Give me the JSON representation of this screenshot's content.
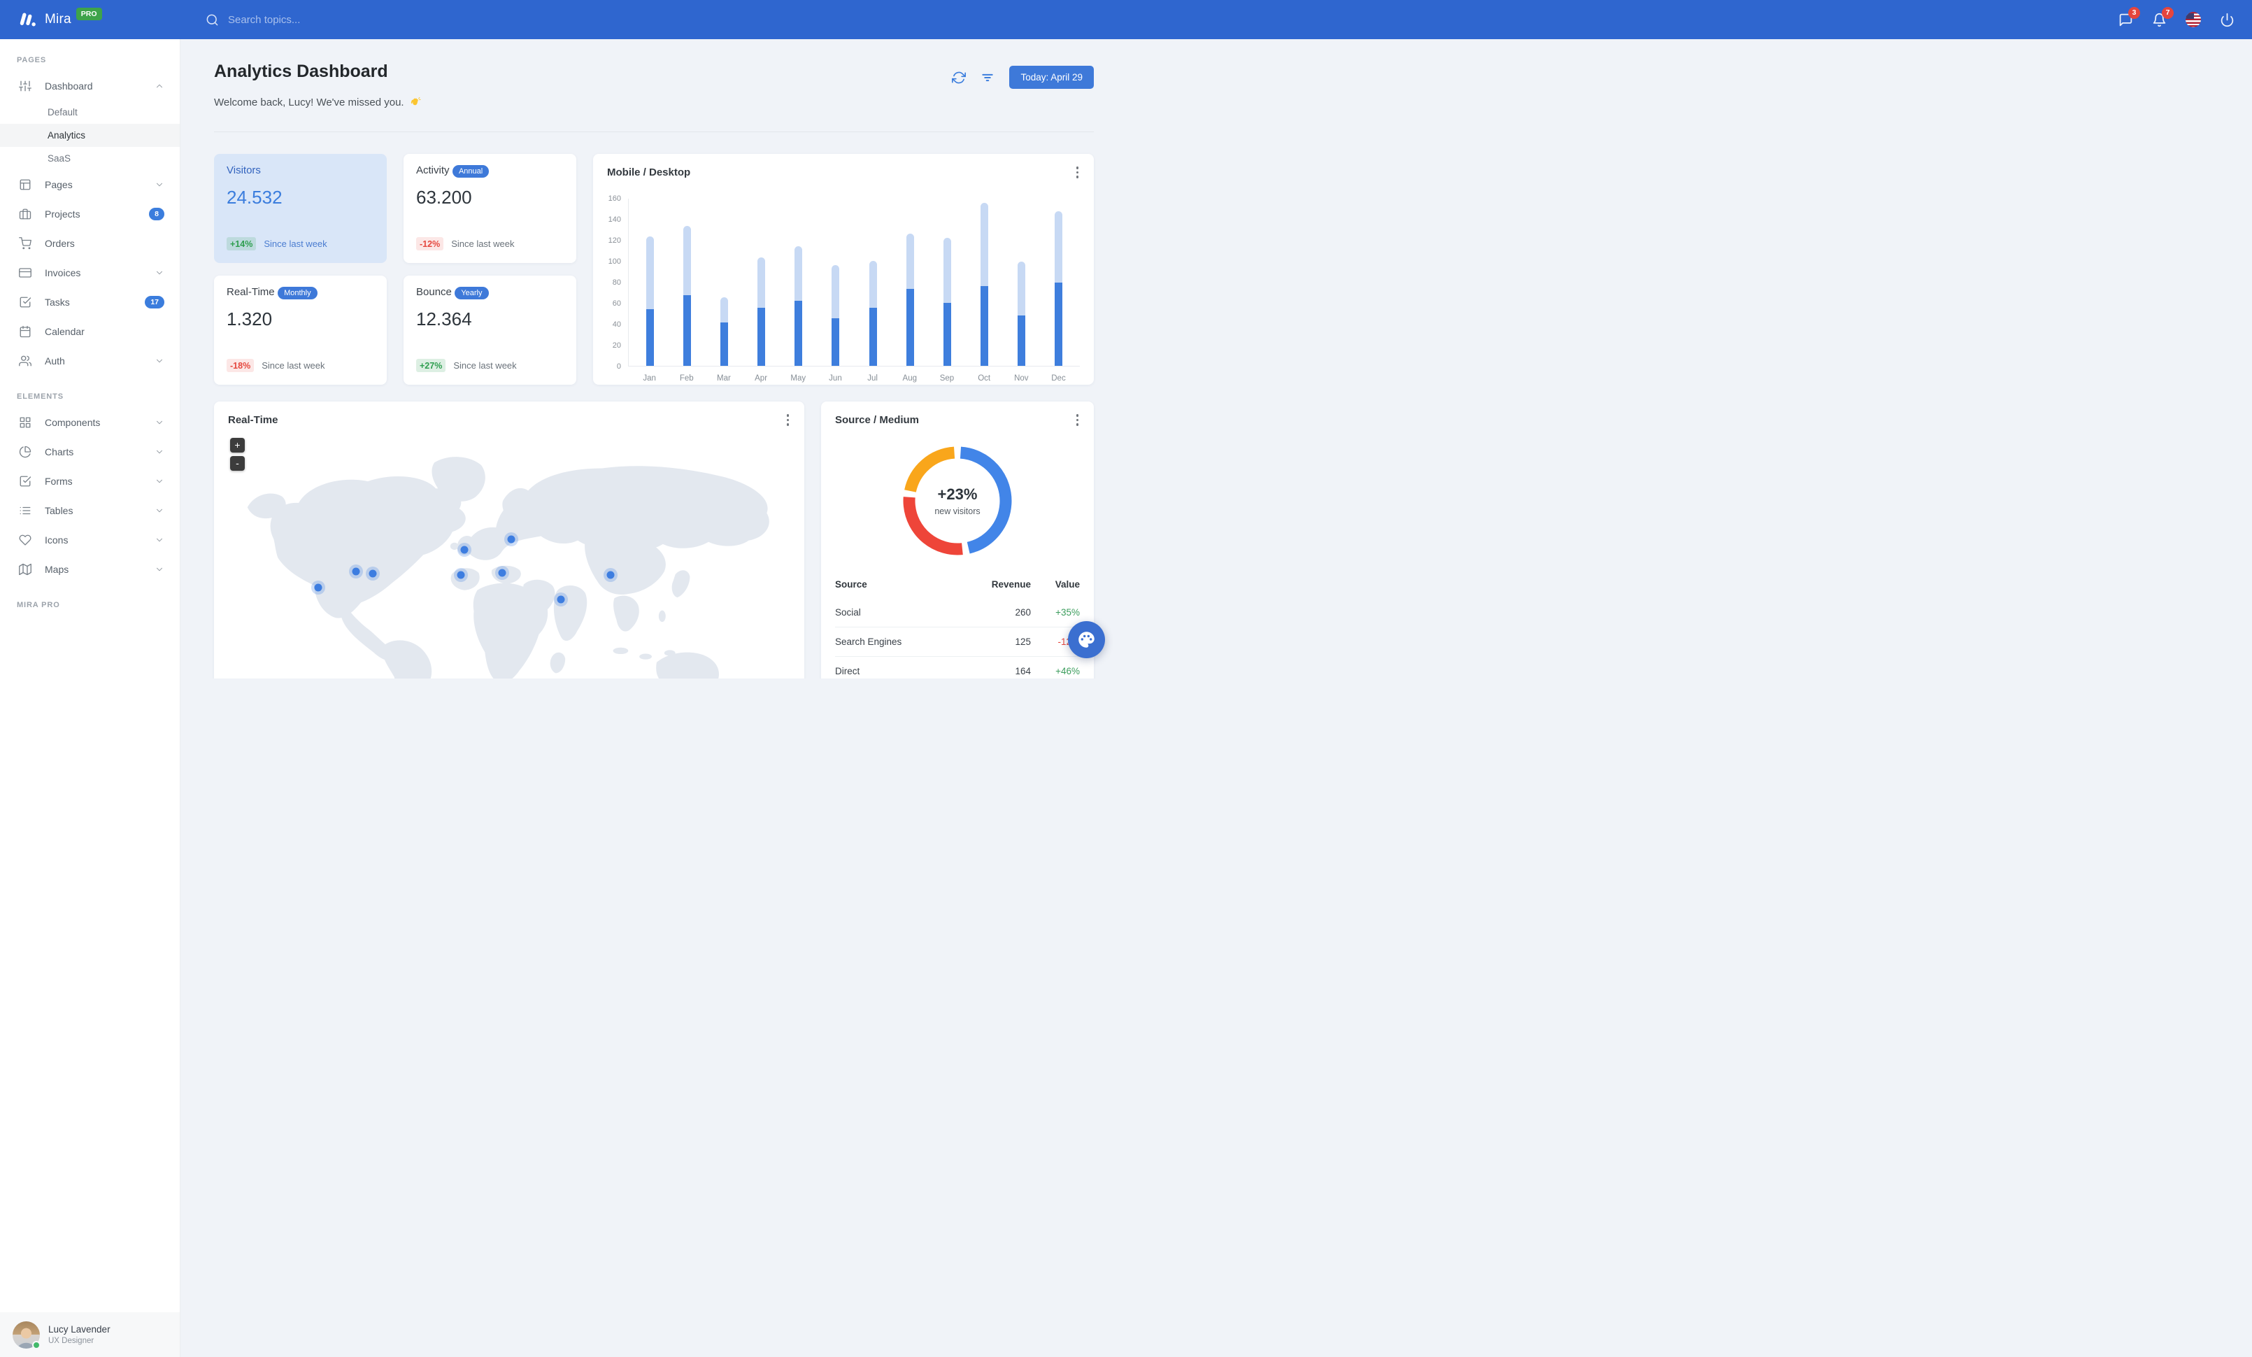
{
  "navbar": {
    "brand": "Mira",
    "brand_badge": "PRO",
    "search_placeholder": "Search topics...",
    "messages_badge": "3",
    "notifications_badge": "7"
  },
  "sidebar": {
    "sections": [
      {
        "label": "PAGES",
        "items": [
          {
            "label": "Dashboard",
            "icon": "sliders-icon",
            "chevron": "up",
            "children": [
              {
                "label": "Default",
                "active": false
              },
              {
                "label": "Analytics",
                "active": true
              },
              {
                "label": "SaaS",
                "active": false
              }
            ]
          },
          {
            "label": "Pages",
            "icon": "layout-icon",
            "chevron": "down"
          },
          {
            "label": "Projects",
            "icon": "briefcase-icon",
            "badge": "8"
          },
          {
            "label": "Orders",
            "icon": "cart-icon"
          },
          {
            "label": "Invoices",
            "icon": "credit-card-icon",
            "chevron": "down"
          },
          {
            "label": "Tasks",
            "icon": "check-square-icon",
            "badge": "17"
          },
          {
            "label": "Calendar",
            "icon": "calendar-icon"
          },
          {
            "label": "Auth",
            "icon": "users-icon",
            "chevron": "down"
          }
        ]
      },
      {
        "label": "ELEMENTS",
        "items": [
          {
            "label": "Components",
            "icon": "grid-icon",
            "chevron": "down"
          },
          {
            "label": "Charts",
            "icon": "pie-chart-icon",
            "chevron": "down"
          },
          {
            "label": "Forms",
            "icon": "check-square-icon",
            "chevron": "down"
          },
          {
            "label": "Tables",
            "icon": "list-icon",
            "chevron": "down"
          },
          {
            "label": "Icons",
            "icon": "heart-icon",
            "chevron": "down"
          },
          {
            "label": "Maps",
            "icon": "map-icon",
            "chevron": "down"
          }
        ]
      },
      {
        "label": "MIRA PRO",
        "items": []
      }
    ],
    "user": {
      "name": "Lucy Lavender",
      "role": "UX Designer",
      "status": "online"
    }
  },
  "header": {
    "title": "Analytics Dashboard",
    "welcome": "Welcome back, Lucy! We've missed you.",
    "date_button": "Today: April 29"
  },
  "stats": [
    {
      "title": "Visitors",
      "value": "24.532",
      "delta": "+14%",
      "delta_type": "positive",
      "note": "Since last week",
      "highlighted": true
    },
    {
      "title": "Activity",
      "badge": "Annual",
      "value": "63.200",
      "delta": "-12%",
      "delta_type": "negative",
      "note": "Since last week"
    },
    {
      "title": "Real-Time",
      "badge": "Monthly",
      "value": "1.320",
      "delta": "-18%",
      "delta_type": "negative",
      "note": "Since last week"
    },
    {
      "title": "Bounce",
      "badge": "Yearly",
      "value": "12.364",
      "delta": "+27%",
      "delta_type": "positive",
      "note": "Since last week"
    }
  ],
  "chart_data": [
    {
      "type": "bar",
      "title": "Mobile / Desktop",
      "stacked": true,
      "categories": [
        "Jan",
        "Feb",
        "Mar",
        "Apr",
        "May",
        "Jun",
        "Jul",
        "Aug",
        "Sep",
        "Oct",
        "Nov",
        "Dec"
      ],
      "series": [
        {
          "name": "Mobile",
          "color": "#3E7EDD",
          "values": [
            54,
            67,
            41,
            55,
            62,
            45,
            55,
            73,
            60,
            76,
            48,
            79
          ]
        },
        {
          "name": "Desktop",
          "color": "#C7D9F4",
          "values": [
            69,
            66,
            24,
            48,
            52,
            51,
            45,
            53,
            62,
            79,
            51,
            68
          ]
        }
      ],
      "ylim": [
        0,
        160
      ],
      "ytick_step": 20,
      "grid": false,
      "legend": "none"
    },
    {
      "type": "pie",
      "title": "Source / Medium",
      "center_value": "+23%",
      "center_label": "new visitors",
      "slices": [
        {
          "label": "Social",
          "value": 260,
          "color": "#4285E8"
        },
        {
          "label": "Direct",
          "value": 164,
          "color": "#EE4539"
        },
        {
          "label": "Search Engines",
          "value": 125,
          "color": "#F9A61B"
        }
      ]
    }
  ],
  "map": {
    "title": "Real-Time",
    "zoom_in": "+",
    "zoom_out": "-",
    "markers": [
      {
        "x": 16.0,
        "y": 58.4
      },
      {
        "x": 22.7,
        "y": 52.4
      },
      {
        "x": 25.7,
        "y": 53.0
      },
      {
        "x": 42.1,
        "y": 44.1
      },
      {
        "x": 41.4,
        "y": 53.5
      },
      {
        "x": 50.4,
        "y": 40.3
      },
      {
        "x": 48.8,
        "y": 52.7
      },
      {
        "x": 59.2,
        "y": 62.7
      },
      {
        "x": 68.0,
        "y": 53.5
      }
    ]
  },
  "source_table": {
    "columns": [
      "Source",
      "Revenue",
      "Value"
    ],
    "rows": [
      {
        "source": "Social",
        "revenue": "260",
        "value": "+35%"
      },
      {
        "source": "Search Engines",
        "revenue": "125",
        "value": "-12%"
      },
      {
        "source": "Direct",
        "revenue": "164",
        "value": "+46%"
      }
    ]
  }
}
